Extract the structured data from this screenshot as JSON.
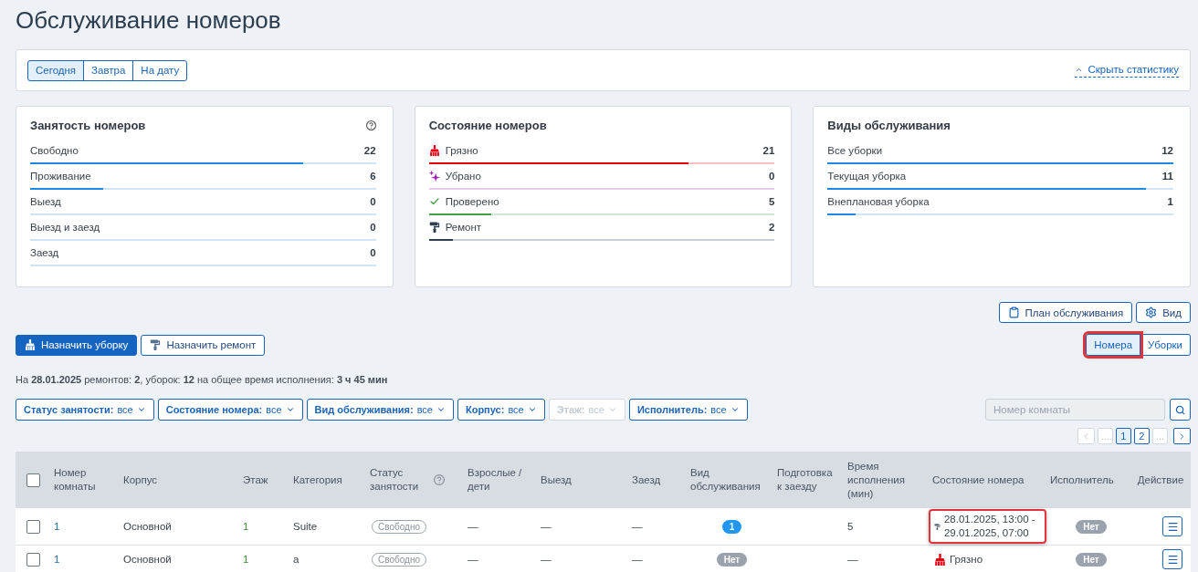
{
  "page": {
    "title": "Обслуживание номеров"
  },
  "period_tabs": [
    {
      "label": "Сегодня",
      "selected": true
    },
    {
      "label": "Завтра",
      "selected": false
    },
    {
      "label": "На дату",
      "selected": false
    }
  ],
  "hide_stats_link": "Скрыть статистику",
  "stat_cards": [
    {
      "title": "Занятость номеров",
      "help": true,
      "items": [
        {
          "label": "Свободно",
          "value": "22",
          "level": 0.79
        },
        {
          "label": "Проживание",
          "value": "6",
          "level": 0.21
        },
        {
          "label": "Выезд",
          "value": "0"
        },
        {
          "label": "Выезд и заезд",
          "value": "0"
        },
        {
          "label": "Заезд",
          "value": "0"
        }
      ]
    },
    {
      "title": "Состояние номеров",
      "help": false,
      "items": [
        {
          "kind": "dirty",
          "label": "Грязно",
          "value": "21",
          "level": 0.75,
          "color": "#e3000f"
        },
        {
          "kind": "cleaned",
          "label": "Убрано",
          "value": "0",
          "color": "#9c27b0"
        },
        {
          "kind": "checked",
          "label": "Проверено",
          "value": "5",
          "level": 0.18,
          "color": "#43a047"
        },
        {
          "kind": "repair",
          "label": "Ремонт",
          "value": "2",
          "level": 0.07,
          "color": "#2c3e50"
        }
      ]
    },
    {
      "title": "Виды обслуживания",
      "help": false,
      "items": [
        {
          "label": "Все уборки",
          "value": "12",
          "level": 1
        },
        {
          "label": "Текущая уборка",
          "value": "11",
          "level": 0.92
        },
        {
          "label": "Внеплановая уборка",
          "value": "1",
          "level": 0.08
        }
      ]
    }
  ],
  "tool_buttons": [
    {
      "kind": "plan",
      "label": "План обслуживания"
    },
    {
      "kind": "view",
      "label": "Вид"
    }
  ],
  "action_buttons": [
    {
      "kind": "clean",
      "label": "Назначить уборку",
      "primary": true
    },
    {
      "kind": "repair",
      "label": "Назначить ремонт",
      "primary": false
    }
  ],
  "view_tabs": [
    {
      "label": "Номера",
      "selected": true,
      "highlighted": true
    },
    {
      "label": "Уборки",
      "selected": false,
      "highlighted": false
    }
  ],
  "summary": "На **28.01.2025** ремонтов: **2**, уборок: **12** на общее время исполнения: **3 ч 45 мин**",
  "filters": [
    {
      "label": "Статус занятости:",
      "value": "все",
      "disabled": false
    },
    {
      "label": "Состояние номера:",
      "value": "все",
      "disabled": false
    },
    {
      "label": "Вид обслуживания:",
      "value": "все",
      "disabled": false
    },
    {
      "label": "Корпус:",
      "value": "все",
      "disabled": false
    },
    {
      "label": "Этаж:",
      "value": "все",
      "disabled": true
    },
    {
      "label": "Исполнитель:",
      "value": "все",
      "disabled": false
    }
  ],
  "room_search": {
    "placeholder": "Номер комнаты"
  },
  "pagination": [
    {
      "kind": "prev",
      "selected": false,
      "disabled": true
    },
    {
      "kind": "ellipsis",
      "text": "...",
      "selected": false,
      "disabled": true
    },
    {
      "kind": "page",
      "text": "1",
      "selected": true,
      "disabled": false
    },
    {
      "kind": "page",
      "text": "2",
      "selected": false,
      "disabled": false
    },
    {
      "kind": "ellipsis",
      "text": "...",
      "selected": false,
      "disabled": true
    },
    {
      "kind": "next",
      "selected": false,
      "disabled": false
    }
  ],
  "table": {
    "select_all_checked": false,
    "columns": [
      {
        "label": "Номер комнаты",
        "help": false
      },
      {
        "label": "Корпус",
        "help": false
      },
      {
        "label": "Этаж",
        "help": false
      },
      {
        "label": "Категория",
        "help": false
      },
      {
        "label": "Статус занятости",
        "help": true
      },
      {
        "label": "Взрослые / дети",
        "help": false
      },
      {
        "label": "Выезд",
        "help": false
      },
      {
        "label": "Заезд",
        "help": false
      },
      {
        "label": "Вид обслуживания",
        "help": false
      },
      {
        "label": "Подготовка к заезду",
        "help": false
      },
      {
        "label": "Время исполнения (мин)",
        "help": false
      },
      {
        "label": "Состояние номера",
        "help": false
      },
      {
        "label": "Исполнитель",
        "help": false
      },
      {
        "label": "Действие",
        "help": false
      }
    ],
    "rows": [
      {
        "checked": false,
        "room": "1",
        "building": "Основной",
        "floor": "1",
        "category": "Suite",
        "occupancy": "Свободно",
        "guests": "—",
        "departure": "—",
        "arrival": "—",
        "service": {
          "kind": "count",
          "text": "1"
        },
        "duration": "5",
        "state": {
          "kind": "repair",
          "text": "28.01.2025, 13:00 - 29.01.2025, 07:00",
          "highlighted": true
        },
        "assignee": "Нет"
      },
      {
        "checked": false,
        "room": "1",
        "building": "Основной",
        "floor": "1",
        "category": "a",
        "occupancy": "Свободно",
        "guests": "—",
        "departure": "—",
        "arrival": "—",
        "service": {
          "kind": "none",
          "text": "Нет"
        },
        "duration": "—",
        "state": {
          "kind": "dirty",
          "text": "Грязно",
          "highlighted": false
        },
        "assignee": "Нет"
      }
    ]
  }
}
